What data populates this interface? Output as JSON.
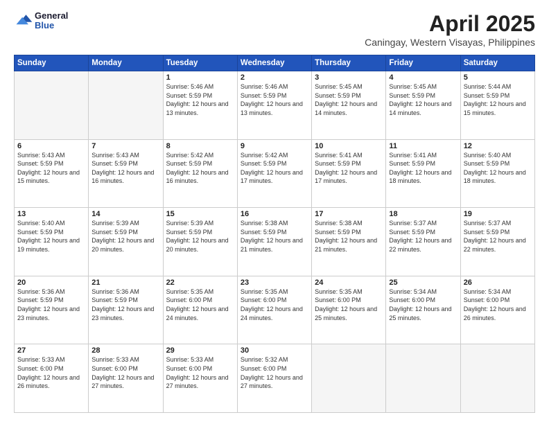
{
  "header": {
    "logo_line1": "General",
    "logo_line2": "Blue",
    "title": "April 2025",
    "subtitle": "Caningay, Western Visayas, Philippines"
  },
  "weekdays": [
    "Sunday",
    "Monday",
    "Tuesday",
    "Wednesday",
    "Thursday",
    "Friday",
    "Saturday"
  ],
  "weeks": [
    [
      {
        "num": "",
        "info": ""
      },
      {
        "num": "",
        "info": ""
      },
      {
        "num": "1",
        "info": "Sunrise: 5:46 AM\nSunset: 5:59 PM\nDaylight: 12 hours and 13 minutes."
      },
      {
        "num": "2",
        "info": "Sunrise: 5:46 AM\nSunset: 5:59 PM\nDaylight: 12 hours and 13 minutes."
      },
      {
        "num": "3",
        "info": "Sunrise: 5:45 AM\nSunset: 5:59 PM\nDaylight: 12 hours and 14 minutes."
      },
      {
        "num": "4",
        "info": "Sunrise: 5:45 AM\nSunset: 5:59 PM\nDaylight: 12 hours and 14 minutes."
      },
      {
        "num": "5",
        "info": "Sunrise: 5:44 AM\nSunset: 5:59 PM\nDaylight: 12 hours and 15 minutes."
      }
    ],
    [
      {
        "num": "6",
        "info": "Sunrise: 5:43 AM\nSunset: 5:59 PM\nDaylight: 12 hours and 15 minutes."
      },
      {
        "num": "7",
        "info": "Sunrise: 5:43 AM\nSunset: 5:59 PM\nDaylight: 12 hours and 16 minutes."
      },
      {
        "num": "8",
        "info": "Sunrise: 5:42 AM\nSunset: 5:59 PM\nDaylight: 12 hours and 16 minutes."
      },
      {
        "num": "9",
        "info": "Sunrise: 5:42 AM\nSunset: 5:59 PM\nDaylight: 12 hours and 17 minutes."
      },
      {
        "num": "10",
        "info": "Sunrise: 5:41 AM\nSunset: 5:59 PM\nDaylight: 12 hours and 17 minutes."
      },
      {
        "num": "11",
        "info": "Sunrise: 5:41 AM\nSunset: 5:59 PM\nDaylight: 12 hours and 18 minutes."
      },
      {
        "num": "12",
        "info": "Sunrise: 5:40 AM\nSunset: 5:59 PM\nDaylight: 12 hours and 18 minutes."
      }
    ],
    [
      {
        "num": "13",
        "info": "Sunrise: 5:40 AM\nSunset: 5:59 PM\nDaylight: 12 hours and 19 minutes."
      },
      {
        "num": "14",
        "info": "Sunrise: 5:39 AM\nSunset: 5:59 PM\nDaylight: 12 hours and 20 minutes."
      },
      {
        "num": "15",
        "info": "Sunrise: 5:39 AM\nSunset: 5:59 PM\nDaylight: 12 hours and 20 minutes."
      },
      {
        "num": "16",
        "info": "Sunrise: 5:38 AM\nSunset: 5:59 PM\nDaylight: 12 hours and 21 minutes."
      },
      {
        "num": "17",
        "info": "Sunrise: 5:38 AM\nSunset: 5:59 PM\nDaylight: 12 hours and 21 minutes."
      },
      {
        "num": "18",
        "info": "Sunrise: 5:37 AM\nSunset: 5:59 PM\nDaylight: 12 hours and 22 minutes."
      },
      {
        "num": "19",
        "info": "Sunrise: 5:37 AM\nSunset: 5:59 PM\nDaylight: 12 hours and 22 minutes."
      }
    ],
    [
      {
        "num": "20",
        "info": "Sunrise: 5:36 AM\nSunset: 5:59 PM\nDaylight: 12 hours and 23 minutes."
      },
      {
        "num": "21",
        "info": "Sunrise: 5:36 AM\nSunset: 5:59 PM\nDaylight: 12 hours and 23 minutes."
      },
      {
        "num": "22",
        "info": "Sunrise: 5:35 AM\nSunset: 6:00 PM\nDaylight: 12 hours and 24 minutes."
      },
      {
        "num": "23",
        "info": "Sunrise: 5:35 AM\nSunset: 6:00 PM\nDaylight: 12 hours and 24 minutes."
      },
      {
        "num": "24",
        "info": "Sunrise: 5:35 AM\nSunset: 6:00 PM\nDaylight: 12 hours and 25 minutes."
      },
      {
        "num": "25",
        "info": "Sunrise: 5:34 AM\nSunset: 6:00 PM\nDaylight: 12 hours and 25 minutes."
      },
      {
        "num": "26",
        "info": "Sunrise: 5:34 AM\nSunset: 6:00 PM\nDaylight: 12 hours and 26 minutes."
      }
    ],
    [
      {
        "num": "27",
        "info": "Sunrise: 5:33 AM\nSunset: 6:00 PM\nDaylight: 12 hours and 26 minutes."
      },
      {
        "num": "28",
        "info": "Sunrise: 5:33 AM\nSunset: 6:00 PM\nDaylight: 12 hours and 27 minutes."
      },
      {
        "num": "29",
        "info": "Sunrise: 5:33 AM\nSunset: 6:00 PM\nDaylight: 12 hours and 27 minutes."
      },
      {
        "num": "30",
        "info": "Sunrise: 5:32 AM\nSunset: 6:00 PM\nDaylight: 12 hours and 27 minutes."
      },
      {
        "num": "",
        "info": ""
      },
      {
        "num": "",
        "info": ""
      },
      {
        "num": "",
        "info": ""
      }
    ]
  ]
}
